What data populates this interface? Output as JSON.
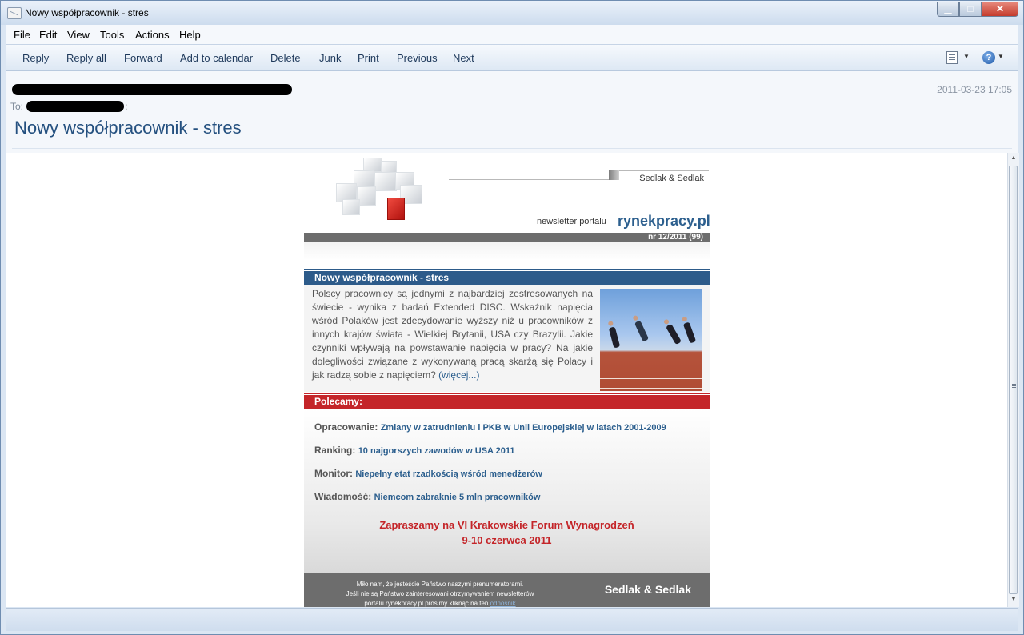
{
  "window": {
    "title": "Nowy współpracownik - stres"
  },
  "menu": [
    "File",
    "Edit",
    "View",
    "Tools",
    "Actions",
    "Help"
  ],
  "toolbar": {
    "buttons": [
      "Reply",
      "Reply all",
      "Forward",
      "Add to calendar",
      "Delete",
      "Junk",
      "Print",
      "Previous",
      "Next"
    ],
    "icons": [
      "encoding-icon",
      "help-icon"
    ]
  },
  "header": {
    "to_label": "To:",
    "to_suffix": ";",
    "date": "2011-03-23 17:05",
    "subject": "Nowy współpracownik - stres"
  },
  "newsletter": {
    "brand_top": "Sedlak & Sedlak",
    "newsletter_of": "newsletter portalu",
    "site": "rynekpracy.pl",
    "issue": "nr 12/2011 (99)",
    "section_title": "Nowy współpracownik - stres",
    "article_text": "Polscy pracownicy są jednymi z najbardziej zestresowanych na świecie - wynika z badań Extended DISC. Wskaźnik napięcia wśród Polaków jest zdecydowanie wyższy niż u pracowników z innych krajów świata - Wielkiej Brytanii, USA czy Brazylii. Jakie czynniki wpływają na powstawanie napięcia w pracy? Na jakie dolegliwości związane z wykonywaną pracą skarżą się Polacy i jak radzą sobie z napięciem? ",
    "more_link": "(więcej...)",
    "recommend_title": "Polecamy:",
    "recommendations": [
      {
        "label": "Opracowanie:",
        "link": "Zmiany w zatrudnieniu i PKB w Unii Europejskiej w latach 2001-2009"
      },
      {
        "label": "Ranking:",
        "link": "10 najgorszych zawodów w USA 2011"
      },
      {
        "label": "Monitor:",
        "link": "Niepełny etat rzadkością wśród menedżerów"
      },
      {
        "label": "Wiadomość:",
        "link": "Niemcom zabraknie 5 mln pracowników"
      }
    ],
    "forum_line1": "Zapraszamy na VI Krakowskie Forum Wynagrodzeń",
    "forum_line2": "9-10 czerwca 2011",
    "footer_line1": "Miło nam, że jesteście Państwo naszymi prenumeratorami.",
    "footer_line2": "Jeśli nie są Państwo zainteresowani otrzymywaniem newsletterów",
    "footer_line3": "portalu rynekpracy.pl prosimy kliknąć na ten ",
    "footer_link": "odnośnik",
    "footer_brand": "Sedlak & Sedlak"
  },
  "colors": {
    "accent_blue": "#2d5b8a",
    "accent_red": "#c42529"
  }
}
